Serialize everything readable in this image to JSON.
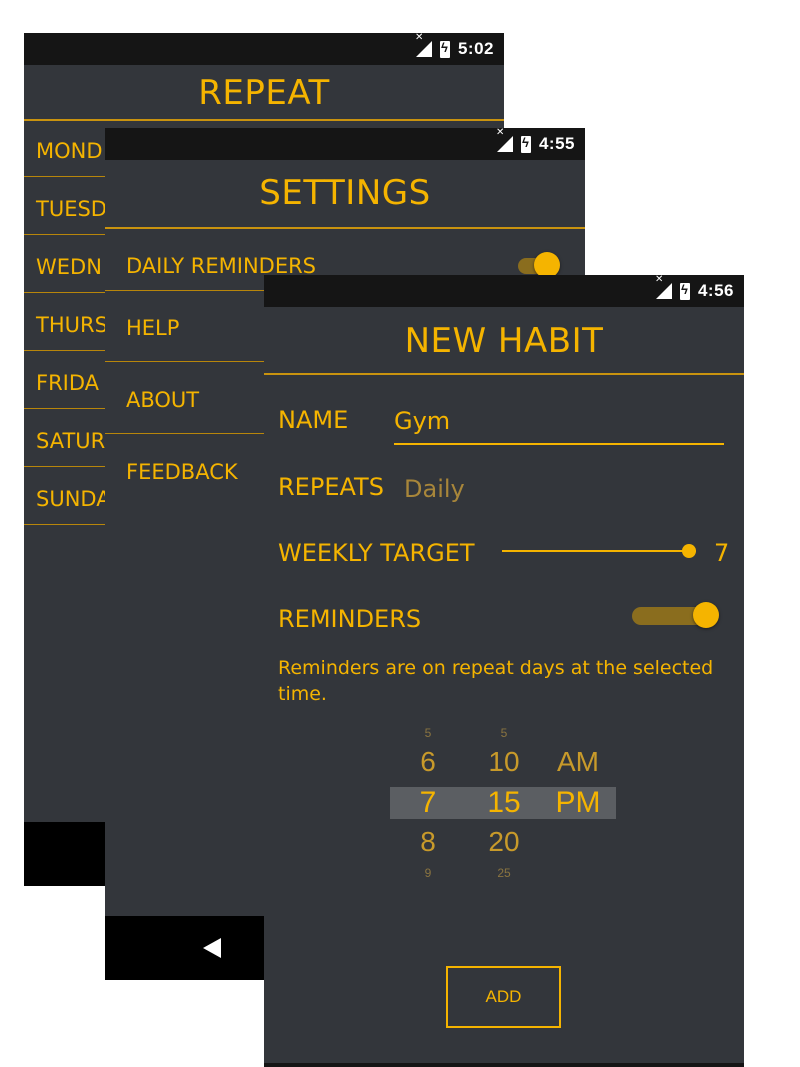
{
  "colors": {
    "accent": "#f5b400",
    "background": "#33363b",
    "statusbar": "#151515"
  },
  "repeat_screen": {
    "time": "5:02",
    "title": "REPEAT",
    "days": [
      "MOND",
      "TUESD",
      "WEDN",
      "THURS",
      "FRIDA",
      "SATUR",
      "SUNDA"
    ]
  },
  "settings_screen": {
    "time": "4:55",
    "title": "SETTINGS",
    "items": [
      {
        "label": "DAILY REMINDERS",
        "toggle": true
      },
      {
        "label": "HELP"
      },
      {
        "label": "ABOUT"
      },
      {
        "label": "FEEDBACK"
      }
    ],
    "nav_back_icon": "back-triangle-icon"
  },
  "new_habit_screen": {
    "time": "4:56",
    "title": "NEW HABIT",
    "name_label": "NAME",
    "name_value": "Gym",
    "repeats_label": "REPEATS",
    "repeats_value": "Daily",
    "weekly_target_label": "WEEKLY TARGET",
    "weekly_target_value": "7",
    "weekly_target_fraction": 1.0,
    "reminders_label": "REMINDERS",
    "reminders_on": true,
    "reminders_hint": "Reminders are on repeat days at the selected time.",
    "picker": {
      "hours": {
        "above2": "5",
        "above1": "6",
        "selected": "7",
        "below1": "8",
        "below2": "9"
      },
      "minutes": {
        "above2": "5",
        "above1": "10",
        "selected": "15",
        "below1": "20",
        "below2": "25"
      },
      "ampm": {
        "above1": "AM",
        "selected": "PM"
      }
    },
    "add_button": "ADD"
  }
}
